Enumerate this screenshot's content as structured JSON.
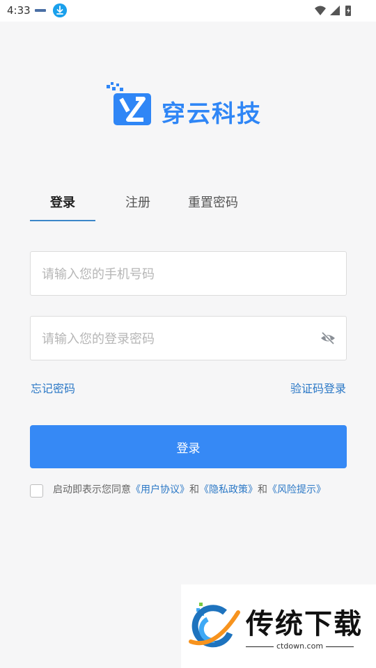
{
  "status_bar": {
    "time": "4:33",
    "icons": [
      "notification-mini-icon",
      "download-icon",
      "wifi-icon",
      "signal-icon",
      "battery-charging-icon"
    ]
  },
  "brand": {
    "name": "穿云科技",
    "color": "#2f86f6"
  },
  "tabs": [
    {
      "label": "登录",
      "active": true
    },
    {
      "label": "注册",
      "active": false
    },
    {
      "label": "重置密码",
      "active": false
    }
  ],
  "form": {
    "phone_value": "",
    "phone_placeholder": "请输入您的手机号码",
    "password_value": "",
    "password_placeholder": "请输入您的登录密码"
  },
  "links": {
    "forgot_password": "忘记密码",
    "sms_login": "验证码登录"
  },
  "login_button": {
    "label": "登录",
    "color": "#3689f5"
  },
  "agreement": {
    "checked": false,
    "prefix": "启动即表示您同意",
    "user_agreement": "《用户协议》",
    "and1": "和",
    "privacy_policy": "《隐私政策》",
    "and2": "和",
    "risk_notice": "《风险提示》"
  },
  "watermark": {
    "title": "传统下载",
    "subtitle": "ctdown.com"
  }
}
